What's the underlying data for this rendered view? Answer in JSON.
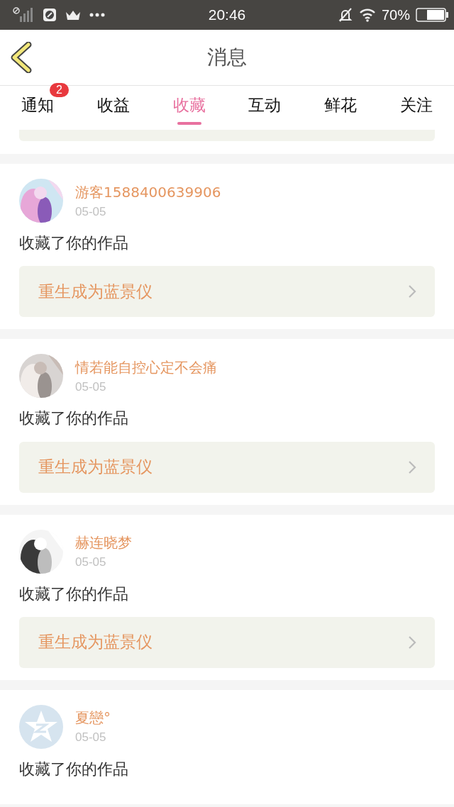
{
  "status_bar": {
    "time": "20:46",
    "battery": "70%"
  },
  "header": {
    "title": "消息"
  },
  "tabs": [
    {
      "label": "通知",
      "selected": false,
      "badge": "2"
    },
    {
      "label": "收益",
      "selected": false
    },
    {
      "label": "收藏",
      "selected": true
    },
    {
      "label": "互动",
      "selected": false
    },
    {
      "label": "鲜花",
      "selected": false
    },
    {
      "label": "关注",
      "selected": false
    }
  ],
  "messages": [
    {
      "user": "游客1588400639906",
      "date": "05-05",
      "text": "收藏了你的作品",
      "work": "重生成为蓝景仪"
    },
    {
      "user": "情若能自控心定不会痛",
      "date": "05-05",
      "text": "收藏了你的作品",
      "work": "重生成为蓝景仪"
    },
    {
      "user": "赫连晓梦",
      "date": "05-05",
      "text": "收藏了你的作品",
      "work": "重生成为蓝景仪"
    },
    {
      "user": "夏戀°",
      "date": "05-05",
      "text": "收藏了你的作品",
      "avatar": {
        "kind": "default"
      }
    }
  ]
}
